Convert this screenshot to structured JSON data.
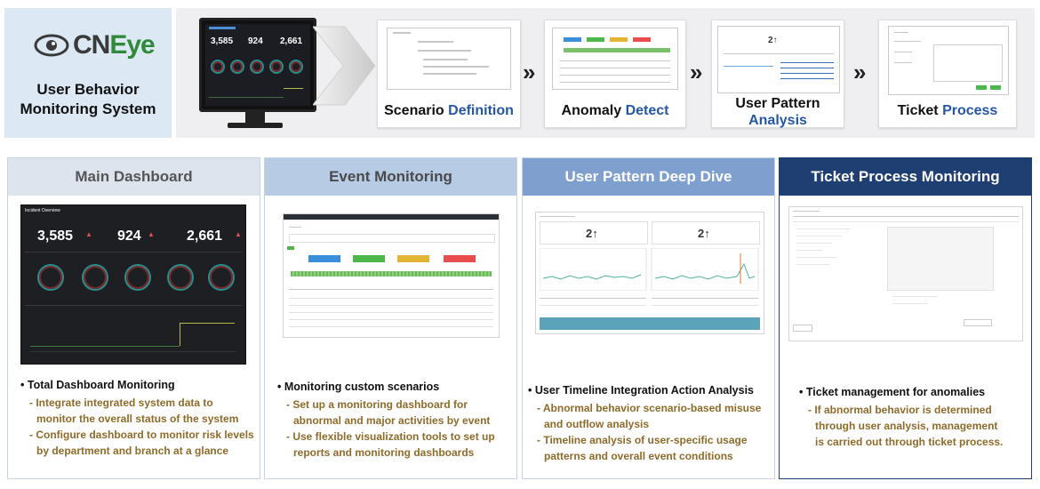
{
  "brand": {
    "logo_cn": "CN",
    "logo_eye": "Eye",
    "title_line1": "User Behavior",
    "title_line2": "Monitoring System"
  },
  "monitor": {
    "kpis": [
      "3,585",
      "924",
      "2,661"
    ]
  },
  "steps": [
    {
      "label": "Scenario",
      "highlight": "Definition"
    },
    {
      "label": "Anomaly",
      "highlight": "Detect"
    },
    {
      "label": "User Pattern",
      "highlight": "Analysis"
    },
    {
      "label": "Ticket",
      "highlight": "Process"
    }
  ],
  "step_separator": "»",
  "colors": {
    "panel1_header": "#dde4ee",
    "panel2_header": "#b7cbe5",
    "panel3_header": "#7f9fcf",
    "panel4_header": "#1f3f72",
    "highlight_blue": "#2557a7",
    "sub_bullet_gold": "#8f6b2a"
  },
  "panels": [
    {
      "title": "Main Dashboard",
      "screenshot": {
        "header": "Incident Overview",
        "kpis": [
          {
            "value": "3,585",
            "delta": "▲"
          },
          {
            "value": "924",
            "delta": "▲"
          },
          {
            "value": "2,661",
            "delta": "▲"
          }
        ]
      },
      "main_bullet": "Total Dashboard Monitoring",
      "sub_bullets": [
        [
          "- Integrate integrated system data to",
          "monitor the overall status of the system"
        ],
        [
          "- Configure dashboard to monitor risk levels",
          "by department and branch at a glance"
        ]
      ]
    },
    {
      "title": "Event Monitoring",
      "main_bullet": "Monitoring custom scenarios",
      "sub_bullets": [
        [
          "- Set up a monitoring dashboard for",
          "abnormal and major activities by event"
        ],
        [
          "- Use flexible visualization tools to set up",
          "reports and monitoring dashboards"
        ]
      ]
    },
    {
      "title": "User Pattern Deep Dive",
      "screenshot": {
        "kpi_left": "2↑",
        "kpi_right": "2↑"
      },
      "main_bullet": "User Timeline Integration Action Analysis",
      "sub_bullets": [
        [
          "- Abnormal behavior scenario-based misuse",
          "and outflow analysis"
        ],
        [
          "- Timeline analysis of user-specific usage",
          "patterns and overall event conditions"
        ]
      ]
    },
    {
      "title": "Ticket Process Monitoring",
      "main_bullet": "Ticket management for anomalies",
      "sub_bullets": [
        [
          "- If abnormal behavior is determined",
          "through user analysis, management",
          "is carried out through ticket process."
        ]
      ]
    }
  ],
  "bullet_char": "•"
}
